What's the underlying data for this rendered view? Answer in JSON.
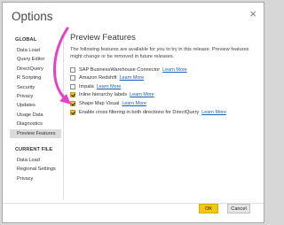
{
  "window": {
    "title": "Options",
    "close_glyph": "×"
  },
  "sidebar": {
    "global_header": "GLOBAL",
    "global_items": [
      {
        "label": "Data Load"
      },
      {
        "label": "Query Editor"
      },
      {
        "label": "DirectQuery"
      },
      {
        "label": "R Scripting"
      },
      {
        "label": "Security"
      },
      {
        "label": "Privacy"
      },
      {
        "label": "Updates"
      },
      {
        "label": "Usage Data"
      },
      {
        "label": "Diagnostics"
      },
      {
        "label": "Preview Features",
        "selected": true
      }
    ],
    "current_header": "CURRENT FILE",
    "current_items": [
      {
        "label": "Data Load"
      },
      {
        "label": "Regional Settings"
      },
      {
        "label": "Privacy"
      }
    ]
  },
  "main": {
    "heading": "Preview Features",
    "description": "The following features are available for you to try in this release. Preview features might change or be removed in future releases.",
    "learn_more": "Learn More",
    "options": [
      {
        "label": "SAP BusinessWarehouse Connector",
        "checked": false
      },
      {
        "label": "Amazon Redshift",
        "checked": false
      },
      {
        "label": "Impala",
        "checked": false
      },
      {
        "label": "Inline hierarchy labels",
        "checked": true
      },
      {
        "label": "Shape Map Visual",
        "checked": true
      },
      {
        "label": "Enable cross filtering in both directions for DirectQuery",
        "checked": true
      }
    ]
  },
  "footer": {
    "ok_label": "OK",
    "cancel_label": "Cancel"
  },
  "colors": {
    "accent": "#f2c811",
    "link": "#1a5fb4",
    "arrow": "#e83ec8"
  }
}
